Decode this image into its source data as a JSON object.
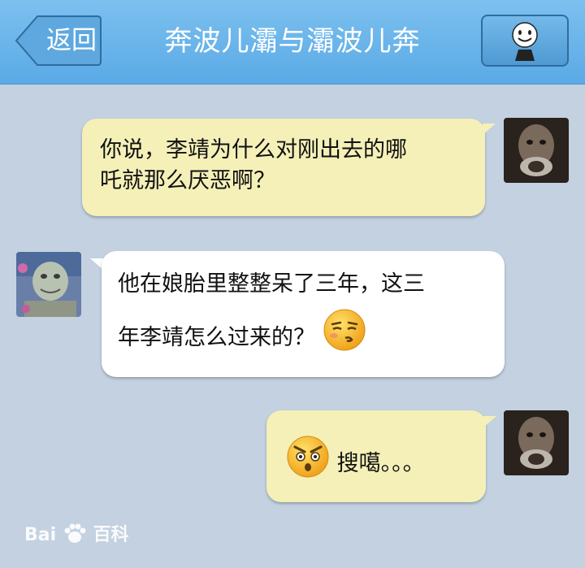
{
  "header": {
    "back_label": "返回",
    "title": "奔波儿灞与灞波儿奔"
  },
  "messages": [
    {
      "side": "right",
      "lines": [
        "你说，李靖为什么对刚出去的哪",
        "吒就那么厌恶啊？"
      ]
    },
    {
      "side": "left",
      "lines": [
        "他在娘胎里整整呆了三年，这三",
        "年李靖怎么过来的？"
      ],
      "emoji": "smirk-emoji"
    },
    {
      "side": "right",
      "text": "搜噶。。。",
      "emoji": "angry-emoji"
    }
  ],
  "watermark": {
    "brand": "Bai",
    "brand2": "百科"
  }
}
